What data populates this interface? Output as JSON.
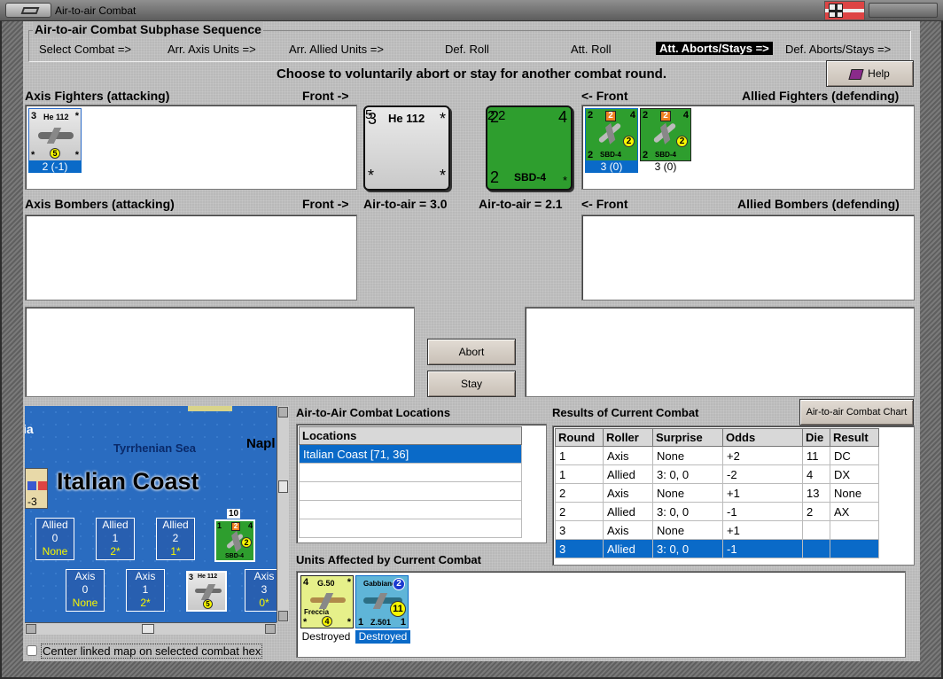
{
  "window": {
    "title": "Air-to-air Combat"
  },
  "sequence": {
    "title": "Air-to-air Combat Subphase Sequence",
    "steps": [
      "Select Combat =>",
      "Arr. Axis Units =>",
      "Arr. Allied Units =>",
      "Def. Roll",
      "Att. Roll",
      "Att. Aborts/Stays =>",
      "Def. Aborts/Stays =>"
    ],
    "active_step": "Att. Aborts/Stays =>"
  },
  "instruction": "Choose to voluntarily abort or stay for another combat round.",
  "help_label": "Help",
  "labels": {
    "axis_fighters": "Axis Fighters (attacking)",
    "front_right": "Front ->",
    "front_left": "<- Front",
    "allied_fighters": "Allied Fighters (defending)",
    "axis_bombers": "Axis Bombers (attacking)",
    "allied_bombers": "Allied Bombers (defending)",
    "axis_air_to_air": "Air-to-air = 3.0",
    "allied_air_to_air": "Air-to-air = 2.1"
  },
  "axis_fighters": [
    {
      "name": "He 112",
      "att": "3",
      "def": "5",
      "star": "*",
      "caption": "2 (-1)"
    }
  ],
  "axis_front": {
    "name": "He 112",
    "att": "3",
    "def": "5",
    "star": "*"
  },
  "allied_front": {
    "name": "SBD-4",
    "left_top": "2",
    "orange": "2",
    "right_top": "4",
    "def": "2",
    "left_bottom": "2",
    "star": "*"
  },
  "allied_fighters": [
    {
      "name": "SBD-4",
      "left_top": "2",
      "orange": "2",
      "right_top": "4",
      "def": "2",
      "left_bottom": "2",
      "caption": "3 (0)"
    },
    {
      "name": "SBD-4",
      "left_top": "2",
      "orange": "2",
      "right_top": "4",
      "def": "2",
      "left_bottom": "2",
      "caption": "3 (0)"
    }
  ],
  "buttons": {
    "abort": "Abort",
    "stay": "Stay",
    "combat_chart": "Air-to-air Combat Chart"
  },
  "map": {
    "sea_label": "Tyrrhenian Sea",
    "place_label": "Napl",
    "region_label": "Italian Coast",
    "edge_label": "ia",
    "hex_counter_edge": "-3",
    "stack_count": "10",
    "allied_boxes": [
      {
        "title": "Allied",
        "num": "0",
        "sub": "None"
      },
      {
        "title": "Allied",
        "num": "1",
        "sub": "2*"
      },
      {
        "title": "Allied",
        "num": "2",
        "sub": "1*"
      }
    ],
    "axis_boxes": [
      {
        "title": "Axis",
        "num": "0",
        "sub": "None"
      },
      {
        "title": "Axis",
        "num": "1",
        "sub": "2*"
      },
      {
        "title": "Axis",
        "num": "3",
        "sub": "0*"
      }
    ],
    "map_counter_green": {
      "name": "SBD-4",
      "left_top": "1",
      "orange": "2",
      "right_top": "4",
      "def": "2"
    },
    "map_counter_grey": {
      "name": "He 112",
      "att": "3",
      "def": "5"
    },
    "center_checkbox_label": "Center linked map on selected combat hex",
    "center_checkbox_checked": false
  },
  "locations": {
    "title": "Air-to-Air Combat Locations",
    "header": "Locations",
    "rows": [
      "Italian Coast [71, 36]"
    ],
    "selected_index": 0
  },
  "results": {
    "title": "Results of Current Combat",
    "headers": [
      "Round",
      "Roller",
      "Surprise",
      "Odds",
      "Die",
      "Result"
    ],
    "rows": [
      [
        "1",
        "Axis",
        "None",
        "+2",
        "11",
        "DC"
      ],
      [
        "1",
        "Allied",
        "3: 0, 0",
        "-2",
        "4",
        "DX"
      ],
      [
        "2",
        "Axis",
        "None",
        "+1",
        "13",
        "None"
      ],
      [
        "2",
        "Allied",
        "3: 0, 0",
        "-1",
        "2",
        "AX"
      ],
      [
        "3",
        "Axis",
        "None",
        "+1",
        "",
        ""
      ],
      [
        "3",
        "Allied",
        "3: 0, 0",
        "-1",
        "",
        ""
      ]
    ],
    "selected_index": 5
  },
  "affected": {
    "title": "Units Affected by Current Combat",
    "units": [
      {
        "top_name": "G.50",
        "sub_name": "Freccia",
        "left_top": "4",
        "def": "4",
        "star": "*",
        "status": "Destroyed",
        "selected": false
      },
      {
        "top_name": "Gabbiano",
        "sub_name": "Z.501",
        "badge": "2",
        "def": "11",
        "left_bottom": "1",
        "right_bottom": "1",
        "status": "Destroyed",
        "selected": true
      }
    ]
  },
  "colors": {
    "selection": "#0a6ac8",
    "allied_counter": "#2e9e2e",
    "axis_counter": "#d0d0d0",
    "sea": "#2a6cc0"
  }
}
